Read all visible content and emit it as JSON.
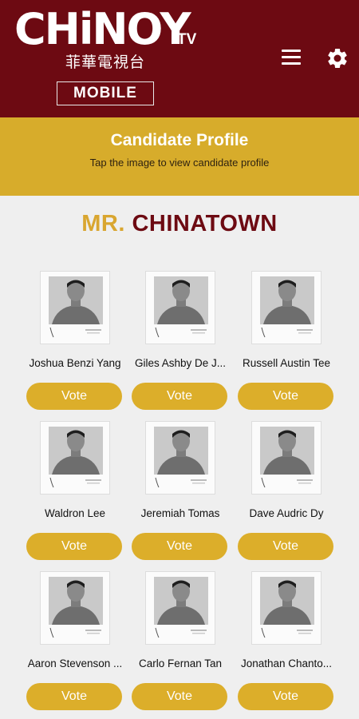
{
  "header": {
    "logo_text": "CHiNOY",
    "logo_tv": "TV",
    "logo_chinese": "菲華電視台",
    "logo_mobile": "MOBILE",
    "menu_icon": "hamburger-menu-icon",
    "settings_icon": "gear-icon"
  },
  "banner": {
    "title": "Candidate Profile",
    "subtitle": "Tap the image to view candidate profile"
  },
  "section": {
    "title_prefix": "MR.",
    "title_main": "CHINATOWN"
  },
  "candidates": [
    {
      "name": "Joshua Benzi Yang",
      "vote_label": "Vote"
    },
    {
      "name": "Giles Ashby De J...",
      "vote_label": "Vote"
    },
    {
      "name": "Russell Austin Tee",
      "vote_label": "Vote"
    },
    {
      "name": "Waldron Lee",
      "vote_label": "Vote"
    },
    {
      "name": "Jeremiah Tomas",
      "vote_label": "Vote"
    },
    {
      "name": "Dave Audric Dy",
      "vote_label": "Vote"
    },
    {
      "name": "Aaron Stevenson ...",
      "vote_label": "Vote"
    },
    {
      "name": "Carlo Fernan Tan",
      "vote_label": "Vote"
    },
    {
      "name": "Jonathan Chanto...",
      "vote_label": "Vote"
    }
  ],
  "colors": {
    "header_bg": "#6d0a12",
    "banner_bg": "#d7ac2b",
    "vote_button": "#dcae2a",
    "title_gold": "#d9a630",
    "title_maroon": "#6d0a12"
  }
}
